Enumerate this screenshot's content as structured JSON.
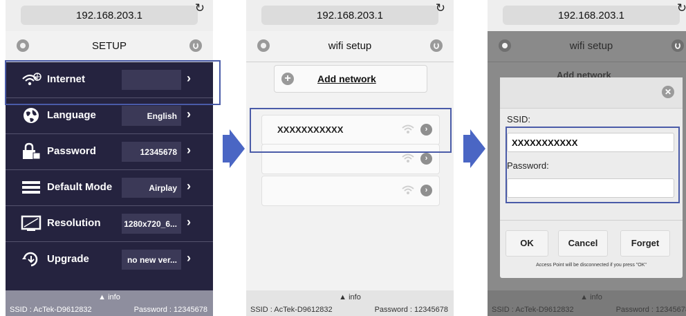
{
  "url": "192.168.203.1",
  "reload_icon": "↻",
  "panel1": {
    "title": "SETUP",
    "items": [
      {
        "label": "Internet",
        "value": "",
        "icon": "wifi-globe-icon"
      },
      {
        "label": "Language",
        "value": "English",
        "icon": "globe-icon"
      },
      {
        "label": "Password",
        "value": "12345678",
        "icon": "lock-icon"
      },
      {
        "label": "Default Mode",
        "value": "Airplay",
        "icon": "list-icon"
      },
      {
        "label": "Resolution",
        "value": "1280x720_6...",
        "icon": "monitor-icon"
      },
      {
        "label": "Upgrade",
        "value": "no new ver...",
        "icon": "upgrade-icon"
      }
    ],
    "footer": {
      "info": "info",
      "ssid": "SSID : AcTek-D9612832",
      "password": "Password : 12345678"
    }
  },
  "panel2": {
    "title": "wifi setup",
    "add_network": "Add network",
    "networks": [
      "XXXXXXXXXXX",
      "",
      ""
    ],
    "footer": {
      "info": "info",
      "ssid": "SSID : AcTek-D9612832",
      "password": "Password : 12345678"
    }
  },
  "panel3": {
    "title": "wifi setup",
    "add_network": "Add network",
    "dialog": {
      "ssid_label": "SSID:",
      "ssid_value": "XXXXXXXXXXX",
      "password_label": "Password:",
      "password_value": "",
      "ok": "OK",
      "cancel": "Cancel",
      "forget": "Forget",
      "notice": "Access Point will be disconnected if you press \"OK\""
    },
    "footer": {
      "info": "info",
      "ssid": "SSID : AcTek-D9612832",
      "password": "Password : 12345678"
    }
  },
  "colors": {
    "menu_bg": "#25233f",
    "highlight": "#4a5ba8",
    "arrow": "#4a66c4"
  }
}
